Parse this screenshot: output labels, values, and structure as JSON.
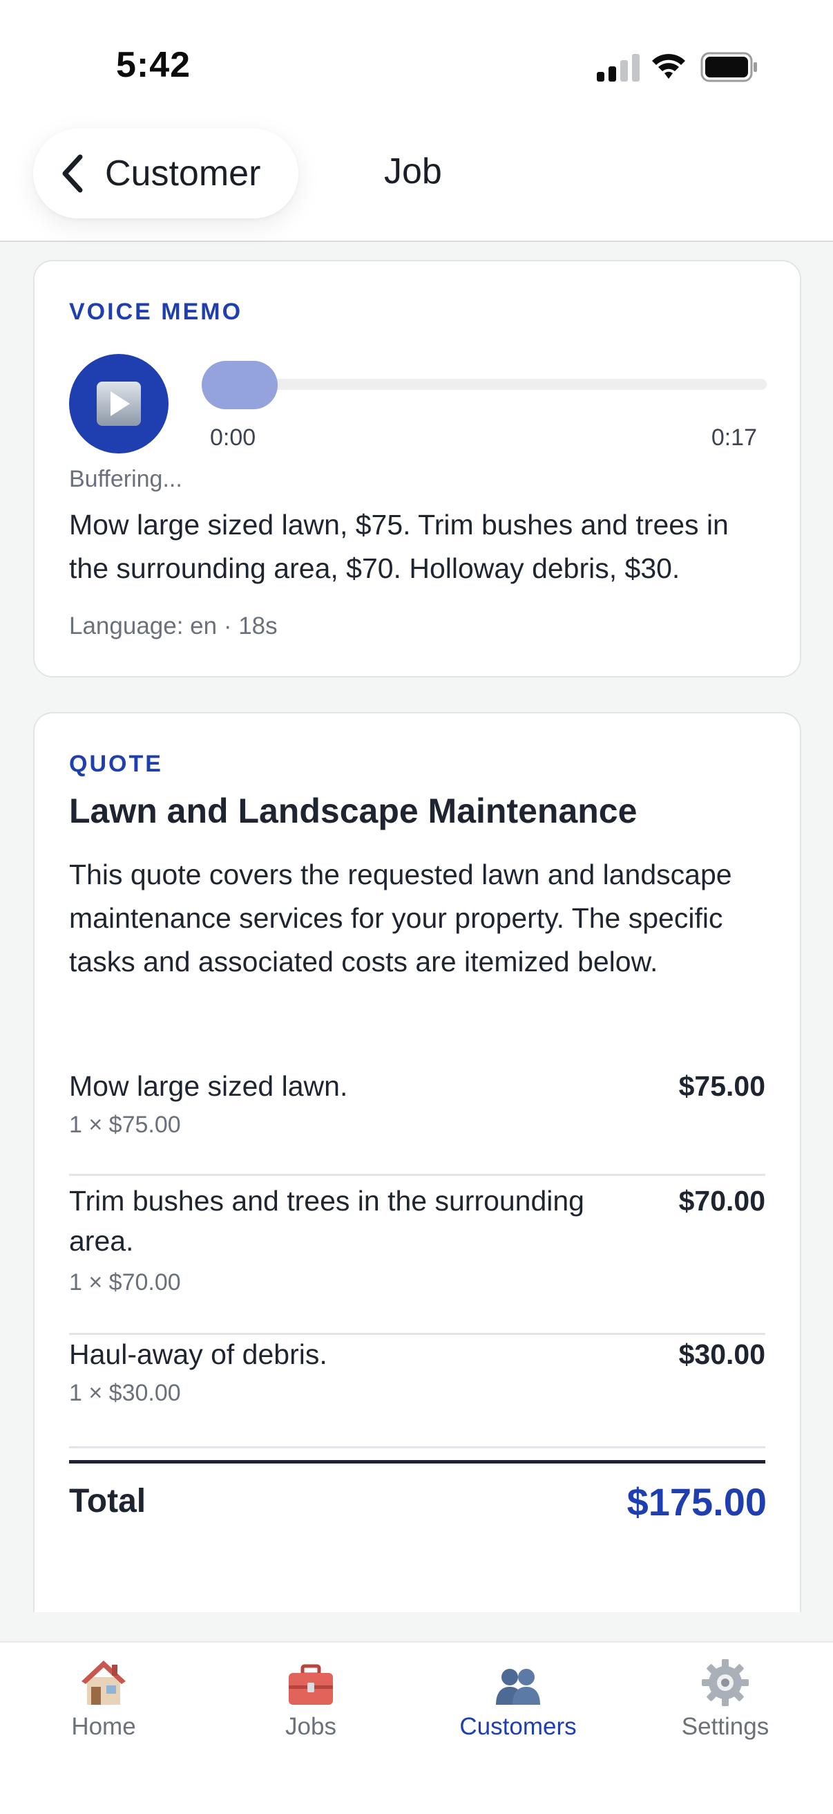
{
  "status_bar": {
    "time": "5:42",
    "icons": [
      "cellular-signal-icon",
      "wifi-icon",
      "battery-icon"
    ]
  },
  "header": {
    "back_label": "Customer",
    "title": "Job"
  },
  "voice_memo": {
    "section_label": "VOICE MEMO",
    "current_time": "0:00",
    "duration": "0:17",
    "progress": 0,
    "status": "Buffering...",
    "transcript": "Mow large sized lawn, $75. Trim bushes and trees in the surrounding area, $70. Holloway debris, $30.",
    "meta": "Language: en · 18s"
  },
  "quote": {
    "section_label": "QUOTE",
    "title": "Lawn and Landscape Maintenance",
    "description": "This quote covers the requested lawn and landscape maintenance services for your property. The specific tasks and associated costs are itemized below.",
    "items": [
      {
        "description": "Mow large sized lawn.",
        "amount": "$75.00",
        "qty": "1 × $75.00"
      },
      {
        "description": "Trim bushes and trees in the surrounding area.",
        "amount": "$70.00",
        "qty": "1 × $70.00"
      },
      {
        "description": "Haul-away of debris.",
        "amount": "$30.00",
        "qty": "1 × $30.00"
      }
    ],
    "total_label": "Total",
    "total_amount": "$175.00"
  },
  "tab_bar": {
    "tabs": [
      {
        "label": "Home",
        "icon": "house-icon",
        "active": false
      },
      {
        "label": "Jobs",
        "icon": "toolbox-icon",
        "active": false
      },
      {
        "label": "Customers",
        "icon": "people-icon",
        "active": true
      },
      {
        "label": "Settings",
        "icon": "gear-icon",
        "active": false
      }
    ]
  },
  "colors": {
    "accent": "#1f3fb0",
    "background": "#f4f5f5",
    "card": "#ffffff",
    "text": "#1f2530",
    "muted": "#6a717c",
    "slider_thumb": "#94a3dc"
  }
}
